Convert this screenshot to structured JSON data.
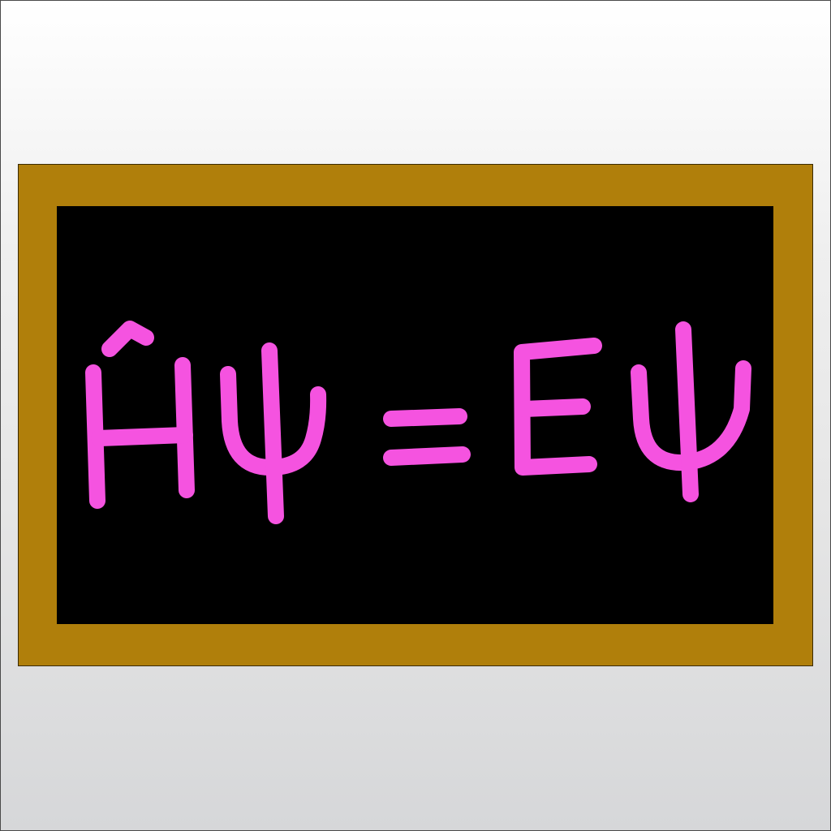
{
  "board": {
    "equation": "Ĥψ = Eψ",
    "chalk_color": "#f553e0",
    "frame_color": "#b07f0b",
    "board_color": "#000000"
  }
}
